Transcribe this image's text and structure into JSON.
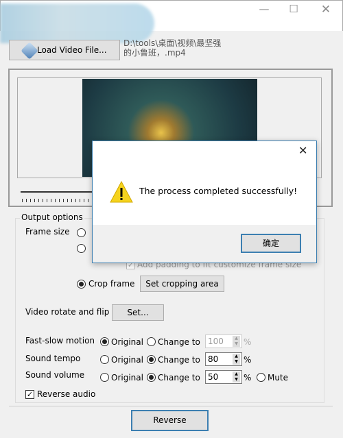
{
  "window": {
    "minimize_icon": "minimize-icon",
    "maximize_icon": "maximize-icon",
    "close_icon": "close-icon"
  },
  "toolbar": {
    "load_label": "Load Video File...",
    "file_path_line1": "D:\\tools\\桌面\\视频\\最坚强",
    "file_path_line2": "的小鲁班，.mp4"
  },
  "output": {
    "group_title": "Output options",
    "frame_size_label": "Frame size",
    "padding_label": "Add padding to fit customize frame size",
    "crop_label": "Crop frame",
    "crop_button": "Set cropping area",
    "rotate_label": "Video rotate and flip",
    "rotate_button": "Set...",
    "fast_slow": {
      "label": "Fast-slow motion",
      "original": "Original",
      "change": "Change to",
      "value": "100",
      "unit": "%",
      "selected": "original"
    },
    "tempo": {
      "label": "Sound tempo",
      "original": "Original",
      "change": "Change to",
      "value": "80",
      "unit": "%",
      "selected": "change"
    },
    "volume": {
      "label": "Sound volume",
      "original": "Original",
      "change": "Change to",
      "value": "50",
      "unit": "%",
      "mute": "Mute",
      "selected": "change"
    },
    "reverse_audio": {
      "label": "Reverse audio",
      "checked": true
    }
  },
  "reverse_button": "Reverse",
  "dialog": {
    "message": "The process completed successfully!",
    "ok": "确定",
    "icon": "warning-icon",
    "accent": "#3c7fb1"
  }
}
